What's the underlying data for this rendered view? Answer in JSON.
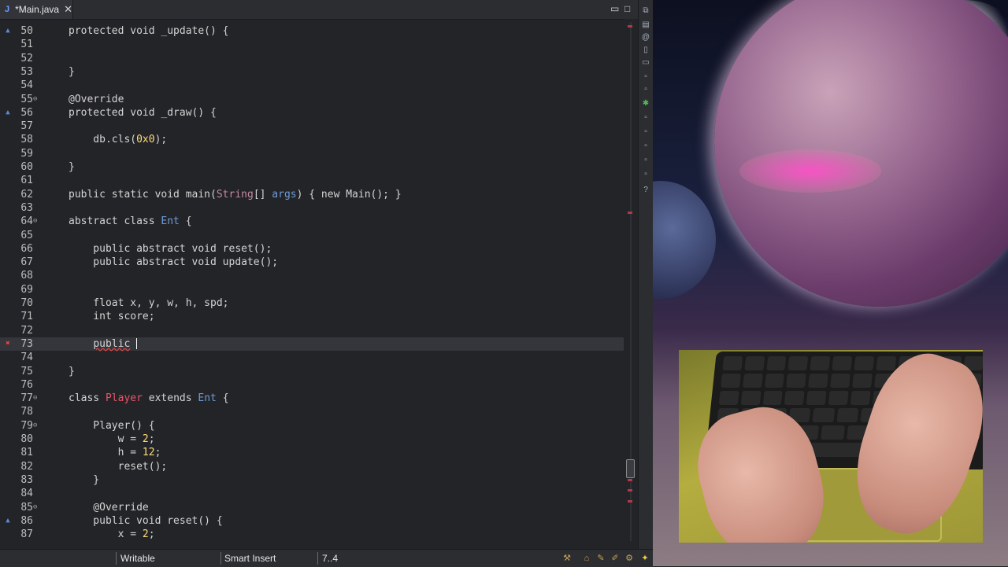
{
  "editor": {
    "tab": {
      "title": "*Main.java",
      "icon": "J",
      "close": "✕"
    },
    "controls": {
      "minimize": "▭",
      "maximize": "□"
    },
    "lines": [
      {
        "n": "50",
        "fold": "",
        "mark": "ov",
        "html": "protected void _update() {"
      },
      {
        "n": "51",
        "html": ""
      },
      {
        "n": "52",
        "html": ""
      },
      {
        "n": "53",
        "html": "}"
      },
      {
        "n": "54",
        "html": ""
      },
      {
        "n": "55",
        "fold": "⊖",
        "html": "@Override"
      },
      {
        "n": "56",
        "mark": "ov",
        "html": "protected void _draw() {"
      },
      {
        "n": "57",
        "html": ""
      },
      {
        "n": "58",
        "html": "    db.cls(<span class=\"num\">0x0</span>);"
      },
      {
        "n": "59",
        "html": ""
      },
      {
        "n": "60",
        "html": "}"
      },
      {
        "n": "61",
        "html": ""
      },
      {
        "n": "62",
        "html": "public static void main(<span class=\"cls\" style=\"color:#c58aa0\">String</span>[] <span class=\"typ\">args</span>) { new Main(); }"
      },
      {
        "n": "63",
        "html": ""
      },
      {
        "n": "64",
        "fold": "⊖",
        "html": "abstract class <span class=\"ent\">Ent</span> {"
      },
      {
        "n": "65",
        "html": ""
      },
      {
        "n": "66",
        "html": "    public abstract void reset();"
      },
      {
        "n": "67",
        "html": "    public abstract void update();"
      },
      {
        "n": "68",
        "html": ""
      },
      {
        "n": "69",
        "html": ""
      },
      {
        "n": "70",
        "html": "    float x, y, w, h, spd;"
      },
      {
        "n": "71",
        "html": "    int score;"
      },
      {
        "n": "72",
        "html": ""
      },
      {
        "n": "73",
        "mark": "err",
        "current": true,
        "html": "    <span style=\"text-decoration:underline wavy #e04040\">public</span> <span class=\"caret\"></span>"
      },
      {
        "n": "74",
        "html": ""
      },
      {
        "n": "75",
        "html": "}"
      },
      {
        "n": "76",
        "html": ""
      },
      {
        "n": "77",
        "fold": "⊖",
        "html": "class <span class=\"pl\">Player</span> extends <span class=\"ent\">Ent</span> {"
      },
      {
        "n": "78",
        "html": ""
      },
      {
        "n": "79",
        "fold": "⊖",
        "html": "    Player() {"
      },
      {
        "n": "80",
        "html": "        w = <span class=\"num\">2</span>;"
      },
      {
        "n": "81",
        "html": "        h = <span class=\"num\">12</span>;"
      },
      {
        "n": "82",
        "html": "        reset();"
      },
      {
        "n": "83",
        "html": "    }"
      },
      {
        "n": "84",
        "html": ""
      },
      {
        "n": "85",
        "fold": "⊖",
        "html": "    @Override"
      },
      {
        "n": "86",
        "mark": "ov",
        "html": "    public void reset() {"
      },
      {
        "n": "87",
        "html": "        x = <span class=\"num\">2</span>;"
      }
    ]
  },
  "status": {
    "mode": "Writable",
    "insert": "Smart Insert",
    "position": "7..4"
  },
  "colors": {
    "editor_bg": "#232428",
    "keyword": "#d4d4d4",
    "type": "#6f9bd8",
    "number": "#ffdc7a",
    "error": "#ff4040"
  }
}
